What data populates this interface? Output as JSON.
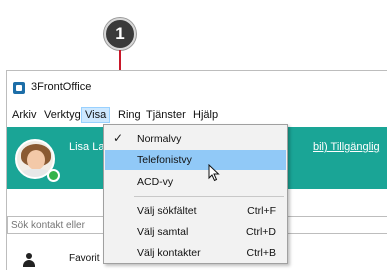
{
  "callout": {
    "number": "1"
  },
  "window": {
    "title": "3FrontOffice"
  },
  "menubar": {
    "items": [
      {
        "label": "Arkiv"
      },
      {
        "label": "Verktyg"
      },
      {
        "label": "Visa"
      },
      {
        "label": "Ring"
      },
      {
        "label": "Tjänster"
      },
      {
        "label": "Hjälp"
      }
    ]
  },
  "user": {
    "name": "Lisa La",
    "status": "bil) Tillgänglig"
  },
  "search": {
    "placeholder": "Sök kontakt eller"
  },
  "favorites": {
    "label": "Favorit"
  },
  "dropdown": {
    "items": [
      {
        "label": "Normalvy",
        "shortcut": "",
        "checked": true
      },
      {
        "label": "Telefonistvy",
        "shortcut": "",
        "checked": false
      },
      {
        "label": "ACD-vy",
        "shortcut": "",
        "checked": false
      },
      {
        "label": "Välj sökfältet",
        "shortcut": "Ctrl+F",
        "checked": false
      },
      {
        "label": "Välj samtal",
        "shortcut": "Ctrl+D",
        "checked": false
      },
      {
        "label": "Välj kontakter",
        "shortcut": "Ctrl+B",
        "checked": false
      }
    ]
  },
  "colors": {
    "accent": "#1aa596",
    "callout_line": "#c8182a",
    "menu_hover": "#91c9f7",
    "status_online": "#33b34a"
  }
}
